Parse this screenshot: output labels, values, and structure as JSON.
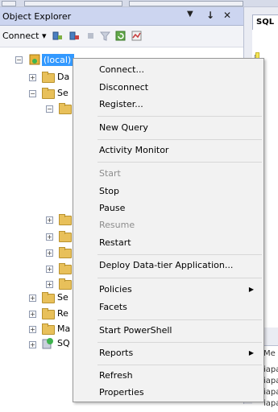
{
  "object_explorer": {
    "title": "Object Explorer",
    "pin_glyph": "↓",
    "close_glyph": "✕",
    "dropdown_glyph": "▼",
    "connect_label": "Connect ▾",
    "tree": {
      "root_label": "(local)",
      "child_labels": [
        "Da",
        "Se",
        "Se",
        "Re",
        "Ma",
        "SQ"
      ]
    }
  },
  "sql_pane": {
    "tab_label": "SQL",
    "messages_label": "Me",
    "message_lines": [
      "iapa",
      "iapa",
      "iapa",
      "iapa"
    ]
  },
  "context_menu": {
    "items": [
      {
        "label": "Connect...",
        "enabled": true
      },
      {
        "label": "Disconnect",
        "enabled": true
      },
      {
        "label": "Register...",
        "enabled": true
      },
      {
        "label": "New Query",
        "enabled": true
      },
      {
        "label": "Activity Monitor",
        "enabled": true
      },
      {
        "label": "Start",
        "enabled": false
      },
      {
        "label": "Stop",
        "enabled": true
      },
      {
        "label": "Pause",
        "enabled": true
      },
      {
        "label": "Resume",
        "enabled": false
      },
      {
        "label": "Restart",
        "enabled": true
      },
      {
        "label": "Deploy Data-tier Application...",
        "enabled": true
      },
      {
        "label": "Policies",
        "enabled": true,
        "submenu": true
      },
      {
        "label": "Facets",
        "enabled": true
      },
      {
        "label": "Start PowerShell",
        "enabled": true
      },
      {
        "label": "Reports",
        "enabled": true,
        "submenu": true
      },
      {
        "label": "Refresh",
        "enabled": true
      },
      {
        "label": "Properties",
        "enabled": true
      }
    ],
    "submenu_arrow": "▶"
  }
}
